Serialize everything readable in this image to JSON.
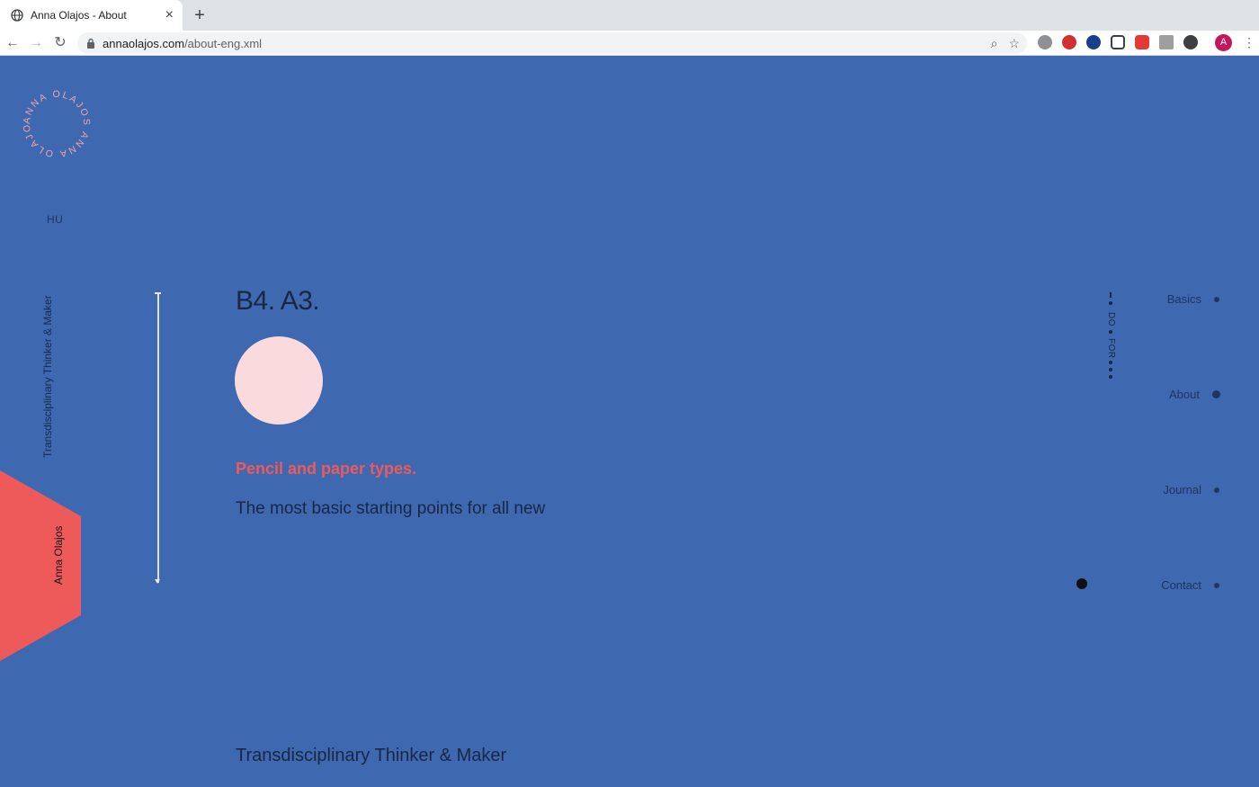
{
  "browser": {
    "tab_title": "Anna Olajos - About",
    "url_host": "annaolajos.com",
    "url_path": "/about-eng.xml",
    "avatar_letter": "A"
  },
  "page": {
    "logo_text": "ANNA OLAJOS ANNA OLAJOS",
    "lang_switch": "HU",
    "vertical_tagline": "Transdisciplinary Thinker & Maker",
    "vertical_name": "Anna Olajos",
    "heading": "B4. A3.",
    "subheading": "Pencil and paper types.",
    "body_text": "The most basic starting points for all new",
    "footer_title": "Transdisciplinary Thinker & Maker",
    "section_indicator": {
      "label_do": "DO",
      "label_for": "FOR"
    },
    "nav": [
      {
        "label": "Basics",
        "active": false
      },
      {
        "label": "About",
        "active": true
      },
      {
        "label": "Journal",
        "active": false
      },
      {
        "label": "Contact",
        "active": false
      }
    ]
  },
  "colors": {
    "background": "#3e69b0",
    "accent": "#ee5a5a",
    "circle": "#fadadd",
    "text_dark": "#1a2742"
  }
}
